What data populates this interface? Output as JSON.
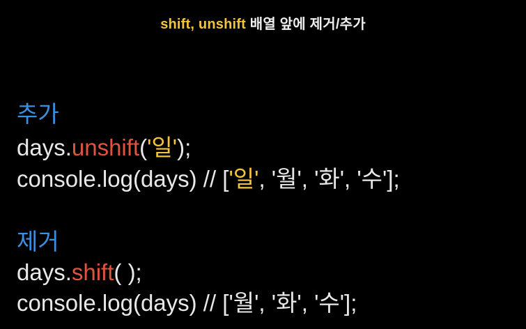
{
  "title": {
    "part1": "shift, unshift",
    "part2": " 배열 앞에 제거/추가"
  },
  "colors": {
    "background": "#000000",
    "title_yellow": "#f5c43d",
    "title_white": "#f0f0f0",
    "heading": "#3b8fe0",
    "code": "#e8e8e8",
    "method": "#e0543f",
    "highlight": "#f5c43d"
  },
  "section_add": {
    "heading": "추가",
    "line1": {
      "prefix": "days.",
      "method": "unshift",
      "open": "(",
      "arg": "'일'",
      "close": ");"
    },
    "line2": {
      "prefix": "console.log(days) // [",
      "first": "'일'",
      "rest": ", '월', '화', '수'];"
    }
  },
  "section_remove": {
    "heading": "제거",
    "line1": {
      "prefix": "days.",
      "method": "shift",
      "rest": "( );"
    },
    "line2": {
      "text": "console.log(days) // ['월', '화', '수'];"
    }
  }
}
